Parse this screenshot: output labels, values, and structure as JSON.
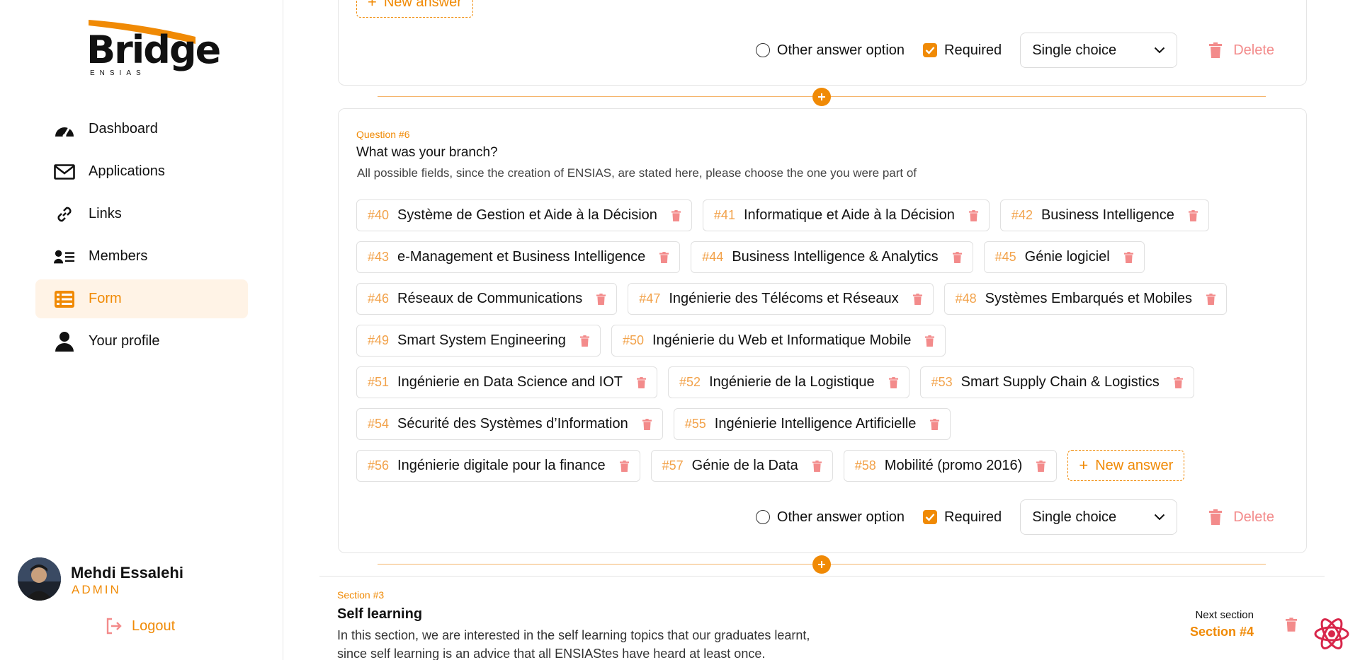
{
  "brand": {
    "name": "Bridge",
    "subtitle": "ENSIAS"
  },
  "sidebar": {
    "items": [
      {
        "label": "Dashboard",
        "icon": "dashboard-icon"
      },
      {
        "label": "Applications",
        "icon": "envelope-icon"
      },
      {
        "label": "Links",
        "icon": "link-icon"
      },
      {
        "label": "Members",
        "icon": "members-list-icon"
      },
      {
        "label": "Form",
        "icon": "form-list-icon",
        "active": true
      },
      {
        "label": "Your profile",
        "icon": "user-icon"
      }
    ],
    "user": {
      "name": "Mehdi Essalehi",
      "role": "ADMIN"
    },
    "logout_label": "Logout"
  },
  "colors": {
    "accent": "#f08a05",
    "accent_light": "#fff3e6",
    "delete": "#f38b8b"
  },
  "question5": {
    "new_answer_label": "New answer",
    "other_option_label": "Other answer option",
    "other_option_checked": false,
    "required_label": "Required",
    "required_checked": true,
    "type": "Single choice",
    "delete_label": "Delete"
  },
  "question6": {
    "number_label": "Question #6",
    "title": "What was your branch?",
    "description": "All possible fields, since the creation of ENSIAS, are stated here, please choose the one you were part of",
    "answers": [
      {
        "id": "#40",
        "text": "Système de Gestion et Aide à la Décision"
      },
      {
        "id": "#41",
        "text": "Informatique et Aide à la Décision"
      },
      {
        "id": "#42",
        "text": "Business Intelligence"
      },
      {
        "id": "#43",
        "text": "e-Management et Business Intelligence"
      },
      {
        "id": "#44",
        "text": "Business Intelligence & Analytics"
      },
      {
        "id": "#45",
        "text": "Génie logiciel"
      },
      {
        "id": "#46",
        "text": "Réseaux de Communications"
      },
      {
        "id": "#47",
        "text": "Ingénierie des Télécoms et Réseaux"
      },
      {
        "id": "#48",
        "text": "Systèmes Embarqués et Mobiles"
      },
      {
        "id": "#49",
        "text": "Smart System Engineering"
      },
      {
        "id": "#50",
        "text": "Ingénierie du Web et Informatique Mobile"
      },
      {
        "id": "#51",
        "text": "Ingénierie en Data Science and IOT"
      },
      {
        "id": "#52",
        "text": "Ingénierie de la Logistique"
      },
      {
        "id": "#53",
        "text": "Smart Supply Chain & Logistics"
      },
      {
        "id": "#54",
        "text": "Sécurité des Systèmes d’Information"
      },
      {
        "id": "#55",
        "text": "Ingénierie Intelligence Artificielle"
      },
      {
        "id": "#56",
        "text": "Ingénierie digitale pour la finance"
      },
      {
        "id": "#57",
        "text": "Génie de la Data"
      },
      {
        "id": "#58",
        "text": "Mobilité (promo 2016)"
      }
    ],
    "new_answer_label": "New answer",
    "other_option_label": "Other answer option",
    "other_option_checked": false,
    "required_label": "Required",
    "required_checked": true,
    "type": "Single choice",
    "delete_label": "Delete"
  },
  "section3": {
    "number_label": "Section #3",
    "title": "Self learning",
    "description": "In this section, we are interested in the self learning topics that our graduates learnt, since self learning is an advice that all ENSIAStes have heard at least once.",
    "next_label": "Next section",
    "next_value": "Section #4"
  }
}
